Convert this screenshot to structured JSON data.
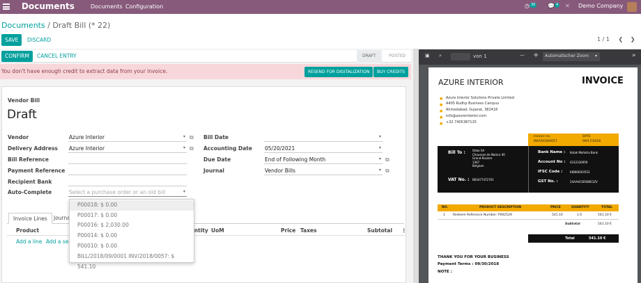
{
  "topbar": {
    "brand": "Documents",
    "menu": [
      "Documents",
      "Configuration"
    ],
    "activity_count": "30",
    "message_count": "4",
    "company": "Demo Company"
  },
  "breadcrumb": {
    "parent": "Documents",
    "separator": "/",
    "current": "Draft Bill (* 22)"
  },
  "toolbar": {
    "save": "SAVE",
    "discard": "DISCARD",
    "pager": "1 / 1"
  },
  "status": {
    "confirm": "CONFIRM",
    "cancel_entry": "CANCEL ENTRY",
    "stages": [
      "DRAFT",
      "POSTED"
    ]
  },
  "alert": {
    "message": "You don't have enough credit to extract data from your invoice.",
    "resend": "RESEND FOR DIGITALIZATION",
    "buy": "BUY CREDITS"
  },
  "form": {
    "type": "Vendor Bill",
    "state": "Draft",
    "vendor_label": "Vendor",
    "vendor": "Azure Interior",
    "delivery_label": "Delivery Address",
    "delivery": "Azure Interior",
    "bill_ref_label": "Bill Reference",
    "payment_ref_label": "Payment Reference",
    "recipient_bank_label": "Recipient Bank",
    "autocomplete_label": "Auto-Complete",
    "autocomplete_placeholder": "Select a purchase order or an old bill",
    "bill_date_label": "Bill Date",
    "accounting_date_label": "Accounting Date",
    "accounting_date": "05/20/2021",
    "due_date_label": "Due Date",
    "due_date": "End of Following Month",
    "journal_label": "Journal",
    "journal": "Vendor Bills"
  },
  "tabs": [
    "Invoice Lines",
    "Journal Items"
  ],
  "lines": {
    "headers": [
      "Product",
      "Quantity",
      "UoM",
      "Price",
      "Taxes",
      "Subtotal"
    ],
    "add_line": "Add a line",
    "add_section": "Add a section"
  },
  "dropdown": [
    "P00018: $ 0.00",
    "P00017: $ 0.00",
    "P00016: $ 2,030.00",
    "P00014: $ 0.00",
    "P00010: $ 0.00",
    "BILL/2018/09/0001    INV/2018/0057: $ 541.10"
  ],
  "pdf": {
    "page_label": "von 1",
    "zoom": "Automatischer Zoom",
    "company": "AZURE INTERIOR",
    "title": "INVOICE",
    "address": [
      "Azure Interior Solutions Private Limited",
      "A405 Rudhp Business Campus",
      "Ahmedabad, Gujarat, 382418",
      "info@azureinterior.com",
      "+32 7405387125"
    ],
    "invoice_no_label": "invoice no.",
    "invoice_no": "INV/2018/0057",
    "date_label": "DATE",
    "date": "09/17/2018",
    "bill_to_label": "Bill To :",
    "bill_to": [
      "Odoo SA",
      "Chaussee de Namur 40",
      "Grand-Rosiere",
      "1367",
      "Belgium"
    ],
    "vat_label": "VAT No. :",
    "vat": "BE0477472701",
    "bank_name_label": "Bank Name :",
    "bank_name": "Kotak Mahidra Bank",
    "account_label": "Account No :",
    "account": "0312330959",
    "ifsc_label": "IFSC Code :",
    "ifsc": "KKBK0003553",
    "gst_label": "GST No. :",
    "gst": "24AAHCS0580E1ZV",
    "table_headers": [
      "NO.",
      "PRODUCT DESCRIPTION",
      "PRICE",
      "QUANTITY",
      "TOTAL"
    ],
    "row": [
      "1",
      "Redeem Reference Number: P002529",
      "541.10",
      "1.0",
      "541.10 €"
    ],
    "subtotal_label": "Subtotal",
    "subtotal": "541.10 €",
    "total_label": "Total",
    "total": "541.10 €",
    "thanks": "THANK YOU FOR YOUR BUSINESS",
    "terms_label": "Payment Terms :",
    "terms": "09/30/2018",
    "note_label": "NOTE :"
  }
}
